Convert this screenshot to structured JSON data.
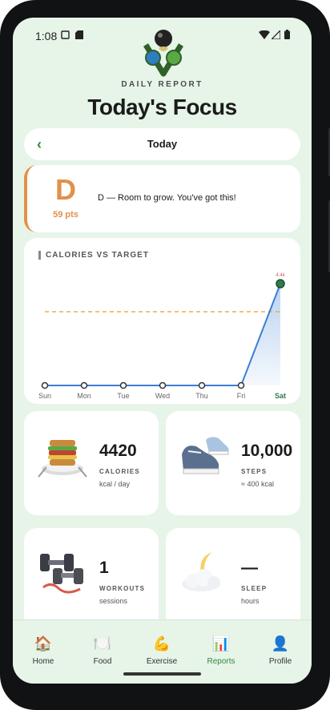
{
  "status_bar": {
    "time": "1:08"
  },
  "header": {
    "eyebrow": "DAILY REPORT",
    "title": "Today's Focus"
  },
  "date_nav": {
    "back_icon": "chevron-left-icon",
    "label": "Today"
  },
  "grade": {
    "letter": "D",
    "points": "59 pts",
    "message": "D — Room to grow. You've got this!",
    "color": "#e3904a"
  },
  "chart_data": {
    "type": "line",
    "title": "CALORIES VS TARGET",
    "categories": [
      "Sun",
      "Mon",
      "Tue",
      "Wed",
      "Thu",
      "Fri",
      "Sat"
    ],
    "highlighted_category": "Sat",
    "series": [
      {
        "values": [
          0,
          0,
          0,
          0,
          0,
          0,
          4420
        ]
      }
    ],
    "target": 3200,
    "ylim": [
      0,
      4420
    ],
    "point_label": "4.4k",
    "line_color": "#3a7fd5",
    "target_color": "#e8b04a",
    "grid": false
  },
  "stats": [
    {
      "icon": "sandwich-plate-icon",
      "value": "4420",
      "label": "CALORIES",
      "sub": "kcal / day"
    },
    {
      "icon": "sneakers-icon",
      "value": "10,000",
      "label": "STEPS",
      "sub": "≈ 400 kcal"
    },
    {
      "icon": "dumbbells-icon",
      "value": "1",
      "label": "WORKOUTS",
      "sub": "sessions"
    },
    {
      "icon": "moon-cloud-icon",
      "value": "—",
      "label": "SLEEP",
      "sub": "hours"
    }
  ],
  "nav": [
    {
      "label": "Home",
      "icon": "🏠",
      "active": false
    },
    {
      "label": "Food",
      "icon": "🍽️",
      "active": false
    },
    {
      "label": "Exercise",
      "icon": "💪",
      "active": false
    },
    {
      "label": "Reports",
      "icon": "📊",
      "active": true
    },
    {
      "label": "Profile",
      "icon": "👤",
      "active": false
    }
  ],
  "colors": {
    "accent": "#2e8b3e",
    "background": "#e7f4e8"
  }
}
